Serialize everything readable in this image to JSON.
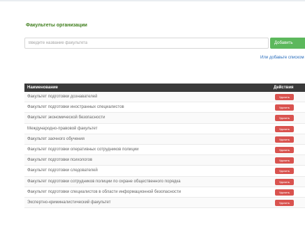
{
  "page": {
    "title": "Факультеты организации"
  },
  "search": {
    "placeholder": "Введите название факультета",
    "value": ""
  },
  "buttons": {
    "add_label": "Добавить",
    "list_link": "Или добавьте списком"
  },
  "table": {
    "headers": {
      "name": "Наименование",
      "actions": "Действия"
    },
    "delete_label": "Удалить",
    "rows": [
      "Факультет подготовки дознавателей",
      "Факультет подготовки иностранных специалистов",
      "Факультет экономической безопасности",
      "Международно-правовой факультет",
      "Факультет заочного обучения",
      "Факультет подготовки оперативных сотрудников полиции",
      "Факультет подготовки психологов",
      "Факультет подготовки следователей",
      "Факультет подготовки сотрудников полиции по охране общественного порядка",
      "Факультет подготовки специалистов в области информационной безопасности",
      "Экспертно-криминалистический факультет"
    ]
  },
  "colors": {
    "title": "#3d7d1a",
    "add_button": "#5cb85c",
    "delete_button": "#d9534f",
    "header": "#3a3a3a",
    "link": "#2a6ebd"
  }
}
